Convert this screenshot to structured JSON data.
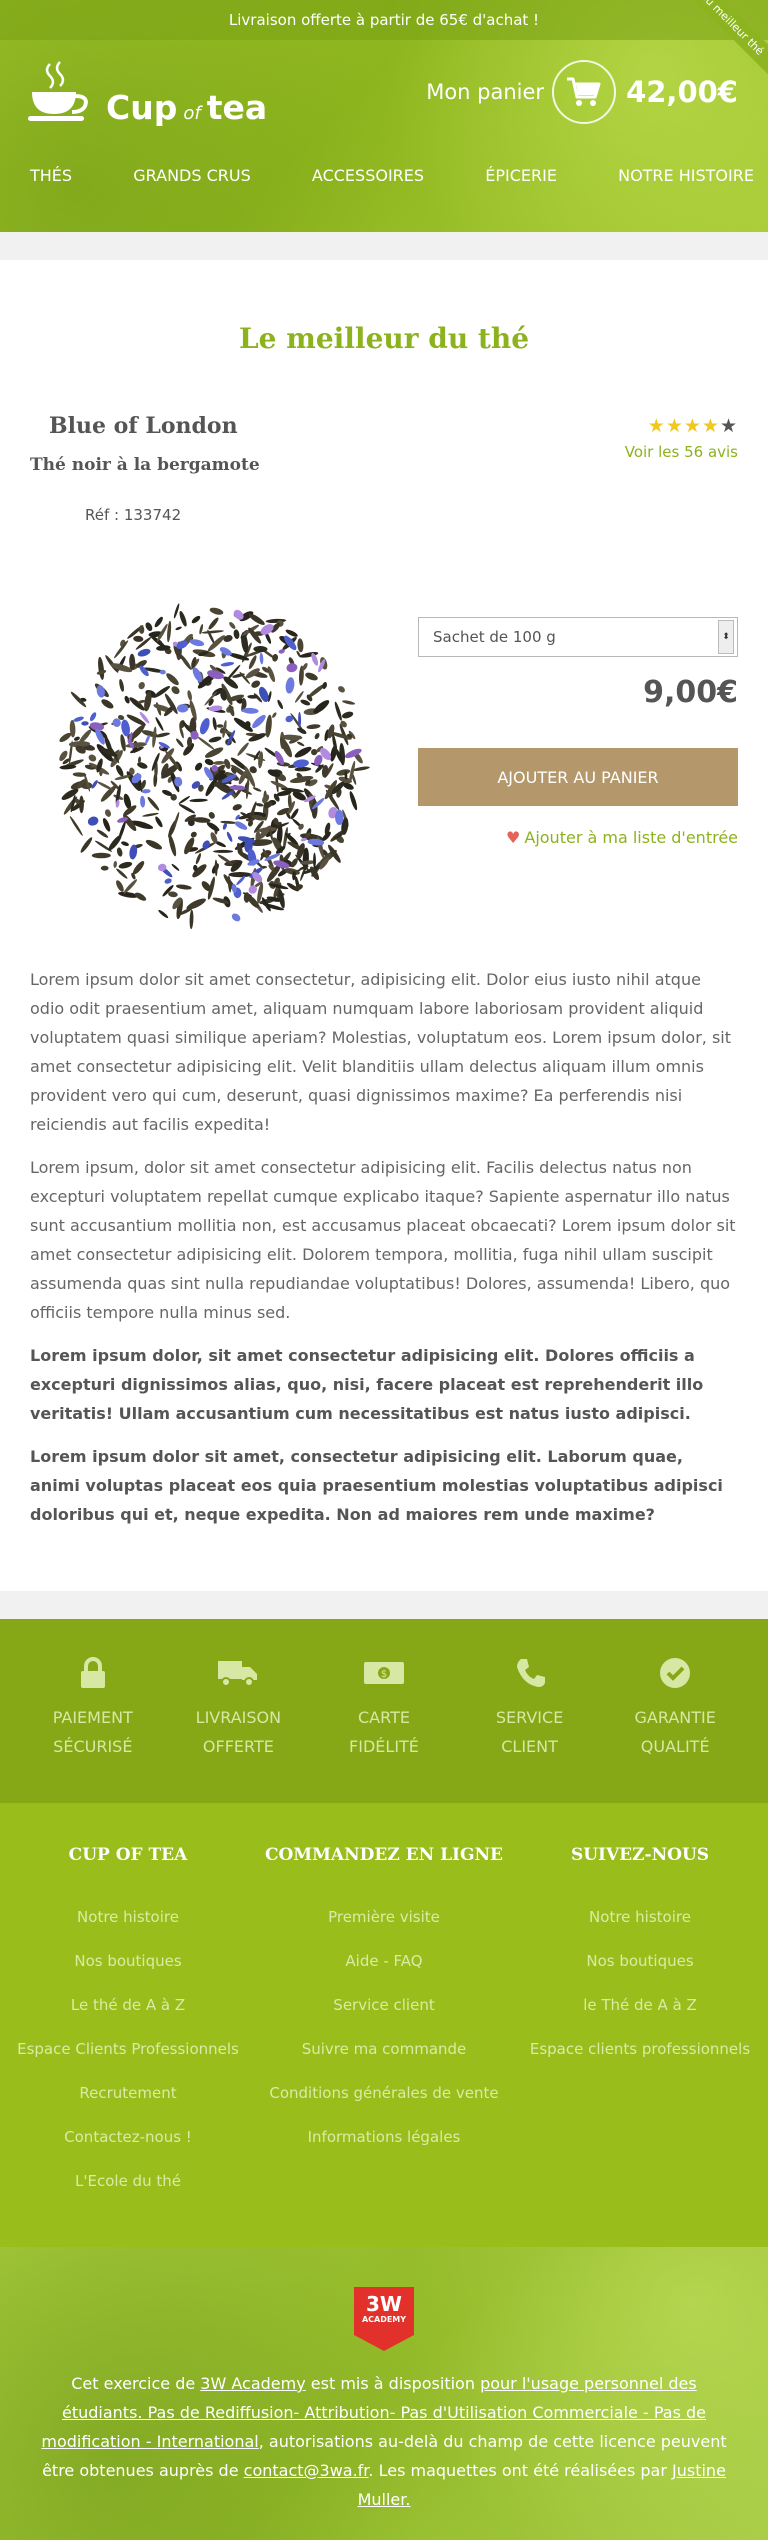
{
  "header": {
    "topbar": "Livraison offerte à partir de 65€ d'achat !",
    "ribbon": "Élu meilleur thé",
    "logo_main": "Cup",
    "logo_of": "of",
    "logo_tea": "tea",
    "cart_label": "Mon panier",
    "cart_total": "42,00€",
    "nav": [
      "THÉS",
      "GRANDS CRUS",
      "ACCESSOIRES",
      "ÉPICERIE",
      "NOTRE HISTOIRE"
    ]
  },
  "main": {
    "section_title": "Le meilleur du thé",
    "product": {
      "name": "Blue of London",
      "subtitle": "Thé noir à la bergamote",
      "ref": "Réf : 133742",
      "rating": 4,
      "rating_max": 5,
      "reviews": "Voir les 56 avis",
      "select_value": "Sachet de 100 g",
      "price": "9,00€",
      "add_to_cart": "AJOUTER AU PANIER",
      "wishlist": "Ajouter à ma liste d'entrée"
    },
    "description": [
      "Lorem ipsum dolor sit amet consectetur, adipisicing elit. Dolor eius iusto nihil atque odio odit praesentium amet, aliquam numquam labore laboriosam provident aliquid voluptatem quasi similique aperiam? Molestias, voluptatum eos. Lorem ipsum dolor, sit amet consectetur adipisicing elit. Velit blanditiis ullam delectus aliquam illum omnis provident vero qui cum, deserunt, quasi dignissimos maxime? Ea perferendis nisi reiciendis aut facilis expedita!",
      "Lorem ipsum, dolor sit amet consectetur adipisicing elit. Facilis delectus natus non excepturi voluptatem repellat cumque explicabo itaque? Sapiente aspernatur illo natus sunt accusantium mollitia non, est accusamus placeat obcaecati? Lorem ipsum dolor sit amet consectetur adipisicing elit. Dolorem tempora, mollitia, fuga nihil ullam suscipit assumenda quas sint nulla repudiandae voluptatibus! Dolores, assumenda! Libero, quo officiis tempore nulla minus sed.",
      "Lorem ipsum dolor, sit amet consectetur adipisicing elit. Dolores officiis a excepturi dignissimos alias, quo, nisi, facere placeat est reprehenderit illo veritatis! Ullam accusantium cum necessitatibus est natus iusto adipisci.",
      "Lorem ipsum dolor sit amet, consectetur adipisicing elit. Laborum quae, animi voluptas placeat eos quia praesentium molestias voluptatibus adipisci doloribus qui et, neque expedita. Non ad maiores rem unde maxime?"
    ]
  },
  "features": [
    {
      "l1": "PAIEMENT",
      "l2": "SÉCURISÉ",
      "icon": "lock-icon"
    },
    {
      "l1": "LIVRAISON",
      "l2": "OFFERTE",
      "icon": "truck-icon"
    },
    {
      "l1": "CARTE",
      "l2": "FIDÉLITÉ",
      "icon": "money-card-icon"
    },
    {
      "l1": "SERVICE",
      "l2": "CLIENT",
      "icon": "phone-icon"
    },
    {
      "l1": "GARANTIE",
      "l2": "QUALITÉ",
      "icon": "check-circle-icon"
    }
  ],
  "footer": {
    "columns": [
      {
        "title": "CUP OF TEA",
        "links": [
          "Notre histoire",
          "Nos boutiques",
          "Le thé de A à Z",
          "Espace Clients Professionnels",
          "Recrutement",
          "Contactez-nous !",
          "L'Ecole du thé"
        ]
      },
      {
        "title": "COMMANDEZ EN LIGNE",
        "links": [
          "Première visite",
          "Aide - FAQ",
          "Service client",
          "Suivre ma commande",
          "Conditions générales de vente",
          "Informations légales"
        ]
      },
      {
        "title": "SUIVEZ-NOUS",
        "links": [
          "Notre histoire",
          "Nos boutiques",
          "le Thé de A à Z",
          "Espace clients professionnels"
        ]
      }
    ]
  },
  "credits": {
    "badge_top": "3W",
    "badge_bottom": "ACADEMY",
    "t1": "Cet exercice de ",
    "l1": "3W Academy",
    "t2": " est mis à disposition ",
    "l2": "pour l'usage personnel des étudiants. Pas de Rediffusion- Attribution- Pas d'Utilisation Commerciale - Pas de modification - International",
    "t3": ", autorisations au-delà du champ de cette licence peuvent être obtenues auprès de ",
    "l3": "contact@3wa.fr",
    "t4": ". Les maquettes ont été réalisées par ",
    "l4": "Justine Muller."
  },
  "colors": {
    "accent": "#8cb21d",
    "button": "#b4986c",
    "features_bg": "#86a816",
    "links_bg": "#99bd1a",
    "star": "#f2c81b"
  }
}
